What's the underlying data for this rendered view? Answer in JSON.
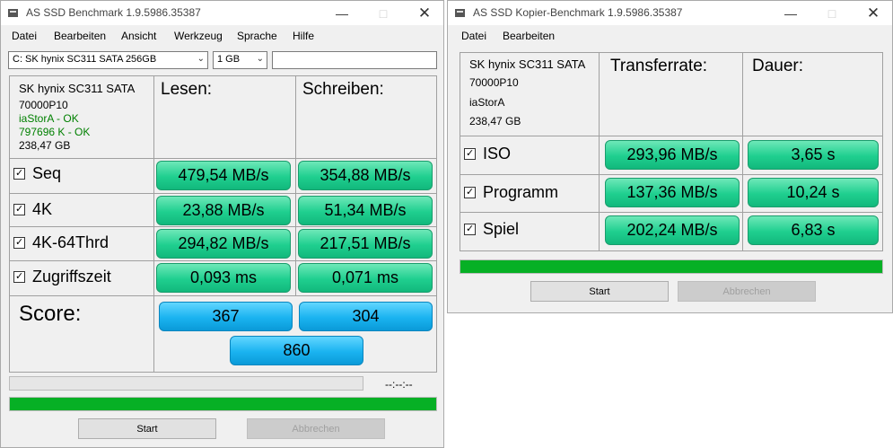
{
  "window_left": {
    "title": "AS SSD Benchmark 1.9.5986.35387",
    "menu": [
      "Datei",
      "Bearbeiten",
      "Ansicht",
      "Werkzeug",
      "Sprache",
      "Hilfe"
    ],
    "drive_select": "C: SK hynix SC311 SATA 256GB",
    "size_select": "1 GB",
    "drive_info": {
      "model": "SK hynix SC311 SATA",
      "firmware": "70000P10",
      "driver": "iaStorA - OK",
      "alignment": "797696 K - OK",
      "capacity": "238,47 GB"
    },
    "col_read": "Lesen:",
    "col_write": "Schreiben:",
    "rows": [
      {
        "label": "Seq",
        "read": "479,54 MB/s",
        "write": "354,88 MB/s"
      },
      {
        "label": "4K",
        "read": "23,88 MB/s",
        "write": "51,34 MB/s"
      },
      {
        "label": "4K-64Thrd",
        "read": "294,82 MB/s",
        "write": "217,51 MB/s"
      },
      {
        "label": "Zugriffszeit",
        "read": "0,093 ms",
        "write": "0,071 ms"
      }
    ],
    "score_label": "Score:",
    "score_read": "367",
    "score_write": "304",
    "score_total": "860",
    "timer": "--:--:--",
    "progress_top": 0,
    "progress_bottom": 1,
    "start": "Start",
    "cancel": "Abbrechen"
  },
  "window_right": {
    "title": "AS SSD Kopier-Benchmark 1.9.5986.35387",
    "menu": [
      "Datei",
      "Bearbeiten"
    ],
    "drive_info": {
      "model": "SK hynix SC311 SATA",
      "firmware": "70000P10",
      "driver": "iaStorA",
      "capacity": "238,47 GB"
    },
    "col_rate": "Transferrate:",
    "col_duration": "Dauer:",
    "rows": [
      {
        "label": "ISO",
        "rate": "293,96 MB/s",
        "duration": "3,65 s"
      },
      {
        "label": "Programm",
        "rate": "137,36 MB/s",
        "duration": "10,24 s"
      },
      {
        "label": "Spiel",
        "rate": "202,24 MB/s",
        "duration": "6,83 s"
      }
    ],
    "progress": 1,
    "start": "Start",
    "cancel": "Abbrechen"
  },
  "colors": {
    "value_box": "#1fcf8f",
    "score_box": "#1ab3f0",
    "progress_fill": "#06b025",
    "ok_text": "#008000"
  }
}
